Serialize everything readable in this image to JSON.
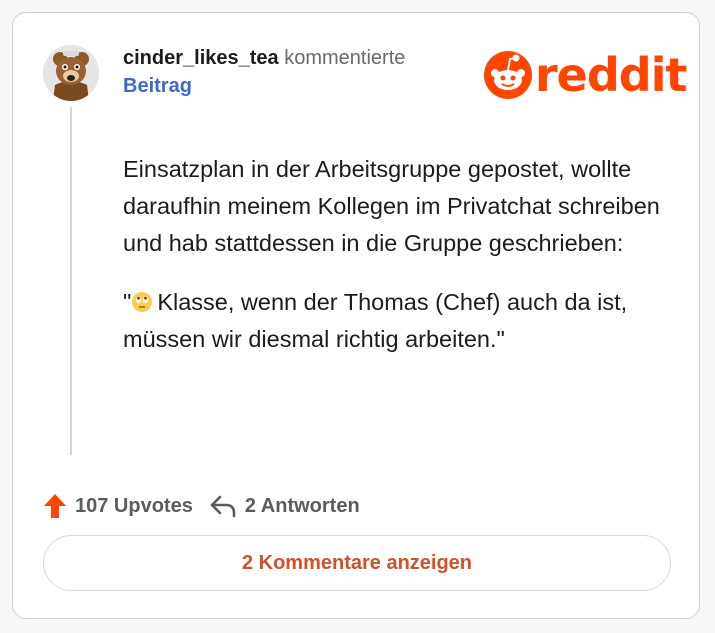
{
  "post": {
    "username": "cinder_likes_tea",
    "action": "kommentierte",
    "target": "Beitrag"
  },
  "brand": {
    "name": "reddit",
    "color": "#ff4500"
  },
  "comment": {
    "paragraphs": [
      "Einsatzplan in der Arbeitsgruppe gepostet, wollte daraufhin meinem Kollegen im Privatchat schreiben und hab stattdessen in die Gruppe geschrieben:"
    ],
    "quote_open": "\"",
    "quote_emoji_icon": "face-with-rolling-eyes-emoji",
    "quote_text": "Klasse, wenn der Thomas (Chef) auch da ist, müssen wir diesmal richtig arbeiten.\""
  },
  "actions": {
    "upvotes_label": "107 Upvotes",
    "replies_label": "2 Antworten",
    "upvote_icon": "upvote-arrow-icon",
    "reply_icon": "reply-arrow-icon"
  },
  "footer": {
    "view_comments_label": "2 Kommentare anzeigen"
  },
  "colors": {
    "accent": "#ff4500",
    "link": "#3a6cc6",
    "button_text": "#d2502a"
  }
}
